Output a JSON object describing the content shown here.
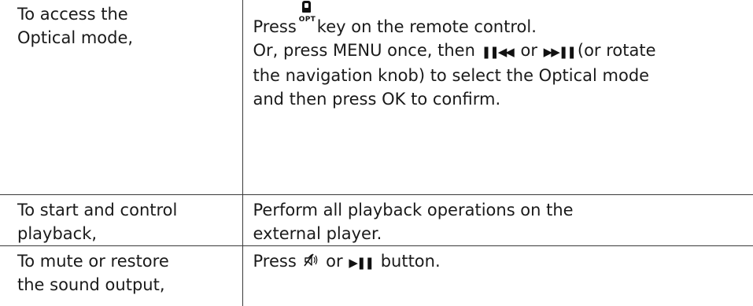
{
  "rows": [
    {
      "condition": [
        "To access the",
        "Optical mode,"
      ],
      "instruction": {
        "line1_pre": "Press",
        "opt_label": "OPT",
        "line1_post": "key on the remote control.",
        "line2_pre": "Or, press MENU once, then",
        "line2_mid": "or",
        "line2_post": "(or rotate",
        "line3": "the navigation knob) to select the Optical mode",
        "line4": "and then press OK to confirm."
      }
    },
    {
      "condition": [
        "To start and control",
        "playback,"
      ],
      "instruction": {
        "line1": "Perform all playback operations on the",
        "line2": "external player."
      }
    },
    {
      "condition": [
        "To mute or restore",
        "the sound output,"
      ],
      "instruction": {
        "line1_pre": "Press",
        "line1_mid": "or",
        "line1_post": "button."
      }
    }
  ],
  "icons": {
    "remote_optical_key": "optical-key-icon",
    "prev_button": "pause-rewind-icon",
    "next_button": "fastforward-pause-icon",
    "mute_button": "mute-icon",
    "play_pause_button": "play-pause-icon"
  }
}
